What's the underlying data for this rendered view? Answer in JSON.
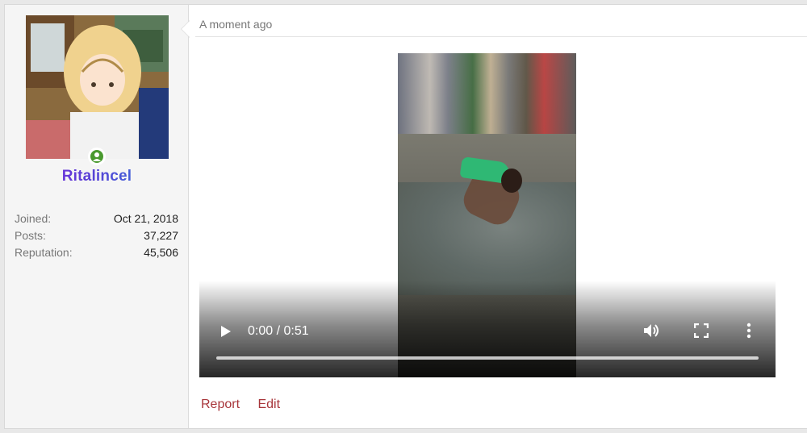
{
  "post": {
    "timestamp": "A moment ago",
    "author": {
      "username": "Ritalincel",
      "online": true,
      "stats": [
        {
          "label": "Joined:",
          "value": "Oct 21, 2018"
        },
        {
          "label": "Posts:",
          "value": "37,227"
        },
        {
          "label": "Reputation:",
          "value": "45,506"
        }
      ]
    },
    "video": {
      "time_display": "0:00 / 0:51",
      "current_time": "0:00",
      "duration": "0:51",
      "progress_fraction": 0.0
    },
    "actions": {
      "report_label": "Report",
      "edit_label": "Edit"
    }
  },
  "colors": {
    "action_link": "#a8363b",
    "online_indicator": "#4a9a2f",
    "username_gradient_start": "#8a2be2",
    "username_gradient_end": "#2fb6b0"
  },
  "icons": {
    "play": "play-icon",
    "volume": "volume-icon",
    "fullscreen": "fullscreen-icon",
    "more": "more-vertical-icon",
    "online": "user-online-icon"
  }
}
